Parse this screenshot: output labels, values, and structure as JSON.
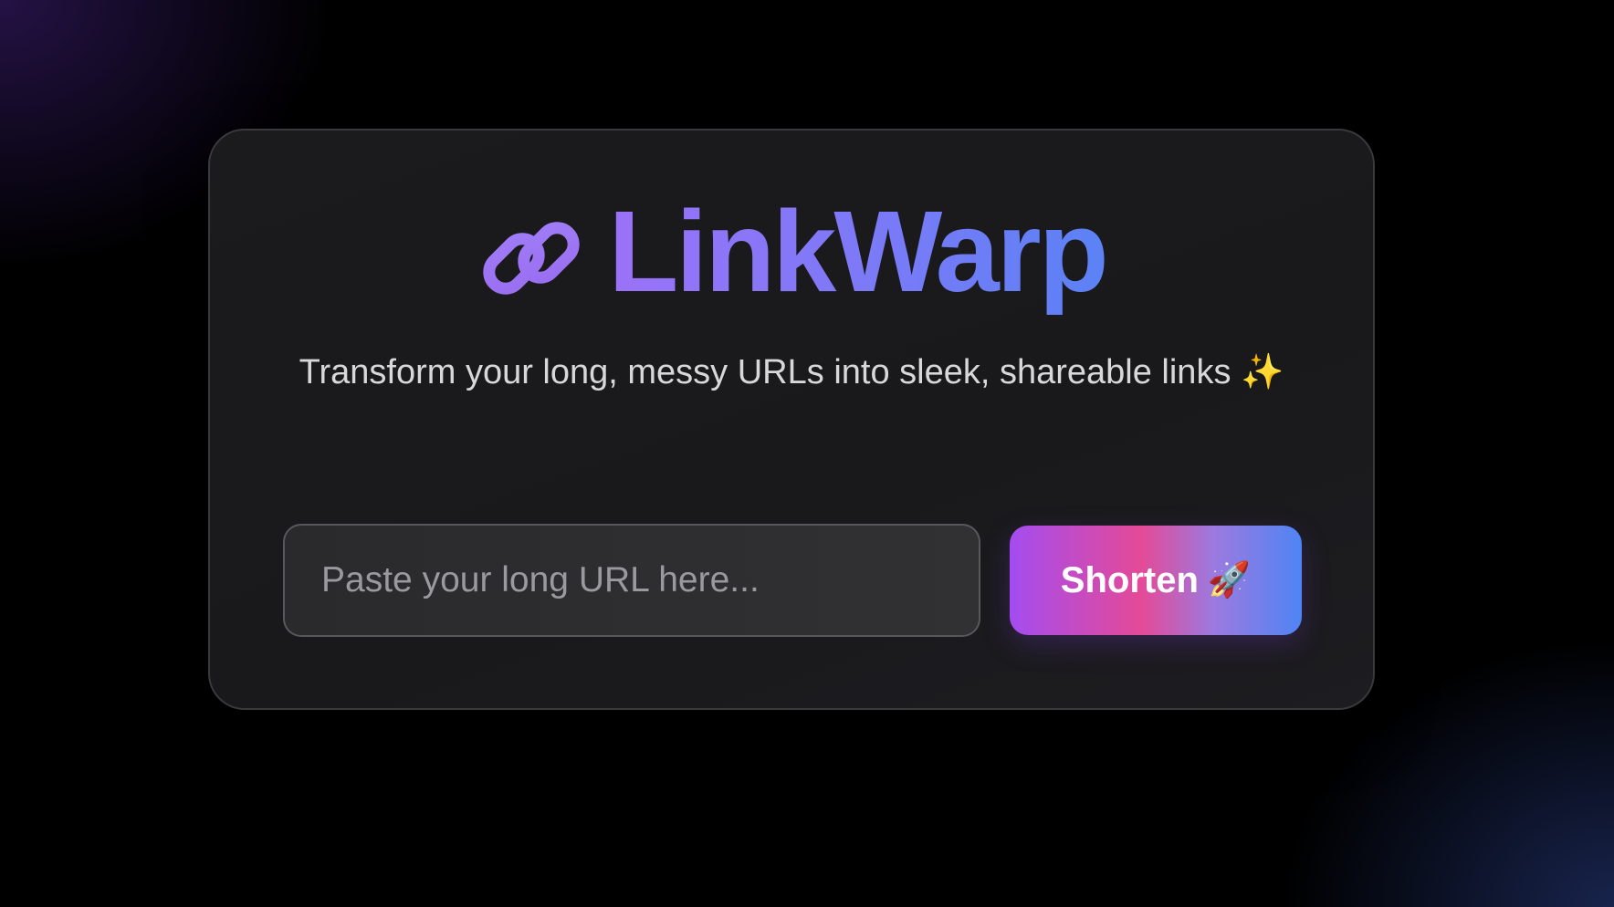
{
  "app": {
    "title": "LinkWarp",
    "logo_icon": "link-chain-icon",
    "tagline": "Transform your long, messy URLs into sleek, shareable links ✨"
  },
  "form": {
    "url_placeholder": "Paste your long URL here...",
    "url_value": "",
    "submit_label": "Shorten",
    "submit_icon": "🚀"
  },
  "colors": {
    "title_gradient_start": "#9b72f7",
    "title_gradient_end": "#5b82f6",
    "button_gradient": [
      "#a44cf0",
      "#e44a97",
      "#9b7ae0",
      "#4f84f4"
    ],
    "card_background": "#1b1b1d",
    "page_background": "#000000"
  }
}
